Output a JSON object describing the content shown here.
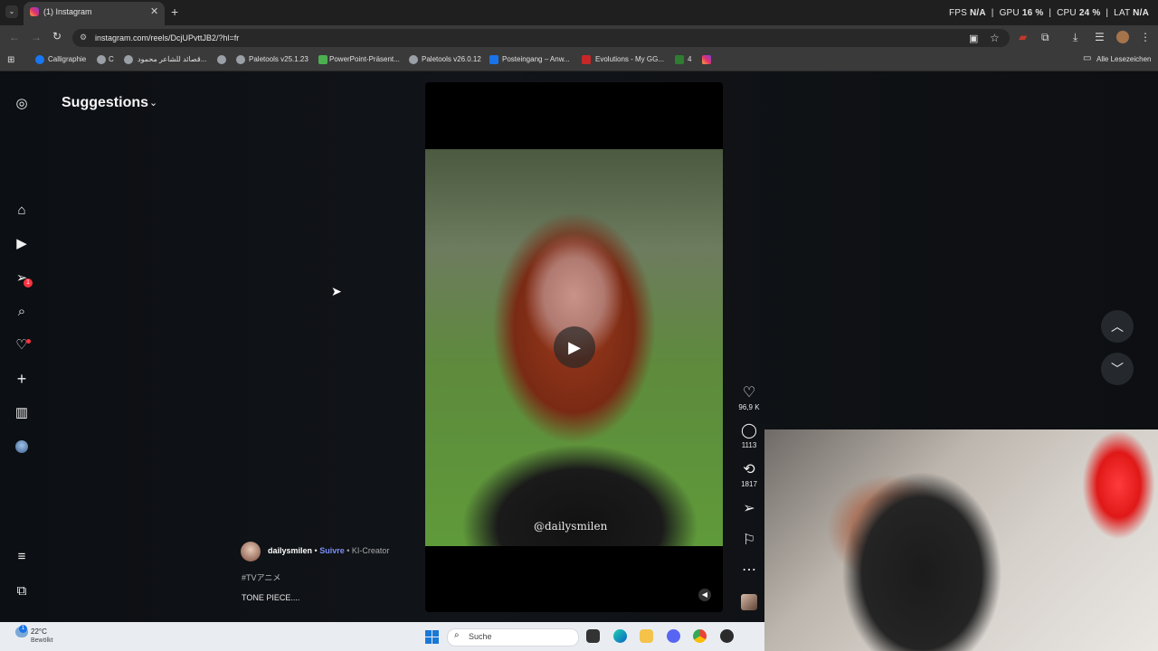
{
  "browser": {
    "tab_title": "(1) Instagram",
    "tab_close": "✕",
    "new_tab": "+",
    "tab_list": "⌄",
    "perf": {
      "fps_label": "FPS",
      "fps_value": "N/A",
      "gpu_label": "GPU",
      "gpu_value": "16 %",
      "cpu_label": "CPU",
      "cpu_value": "24 %",
      "lat_label": "LAT",
      "lat_value": "N/A"
    },
    "url": "instagram.com/reels/DcjUPvttJB2/?hl=fr",
    "bookmarks": [
      "Calligraphie",
      "C",
      "قصائد للشاعر محمود...",
      "Paletools v25.1.23",
      "PowerPoint-Präsent...",
      "Paletools v26.0.12",
      "Posteingang – Anw...",
      "Evolutions - My GG...",
      "4"
    ],
    "all_bookmarks": "Alle Lesezeichen"
  },
  "sidebar": {
    "title": "Suggestions",
    "notif_count": "1"
  },
  "reel": {
    "watermark": "@dailysmilen",
    "author": "dailysmilen",
    "separator1": " • ",
    "follow": "Suivre",
    "separator2": " • ",
    "creator": "KI-Creator",
    "hashtag": "#TVアニメ",
    "caption": "TONE PIECE....",
    "likes": "96,9 K",
    "comments": "1113",
    "reposts": "1817"
  },
  "taskbar": {
    "temperature": "22°C",
    "weather": "Bewölkt",
    "weather_badge": "1",
    "search": "Suche"
  },
  "colors": {
    "accent_follow": "#7c8ff5",
    "badge": "#ff3040"
  }
}
